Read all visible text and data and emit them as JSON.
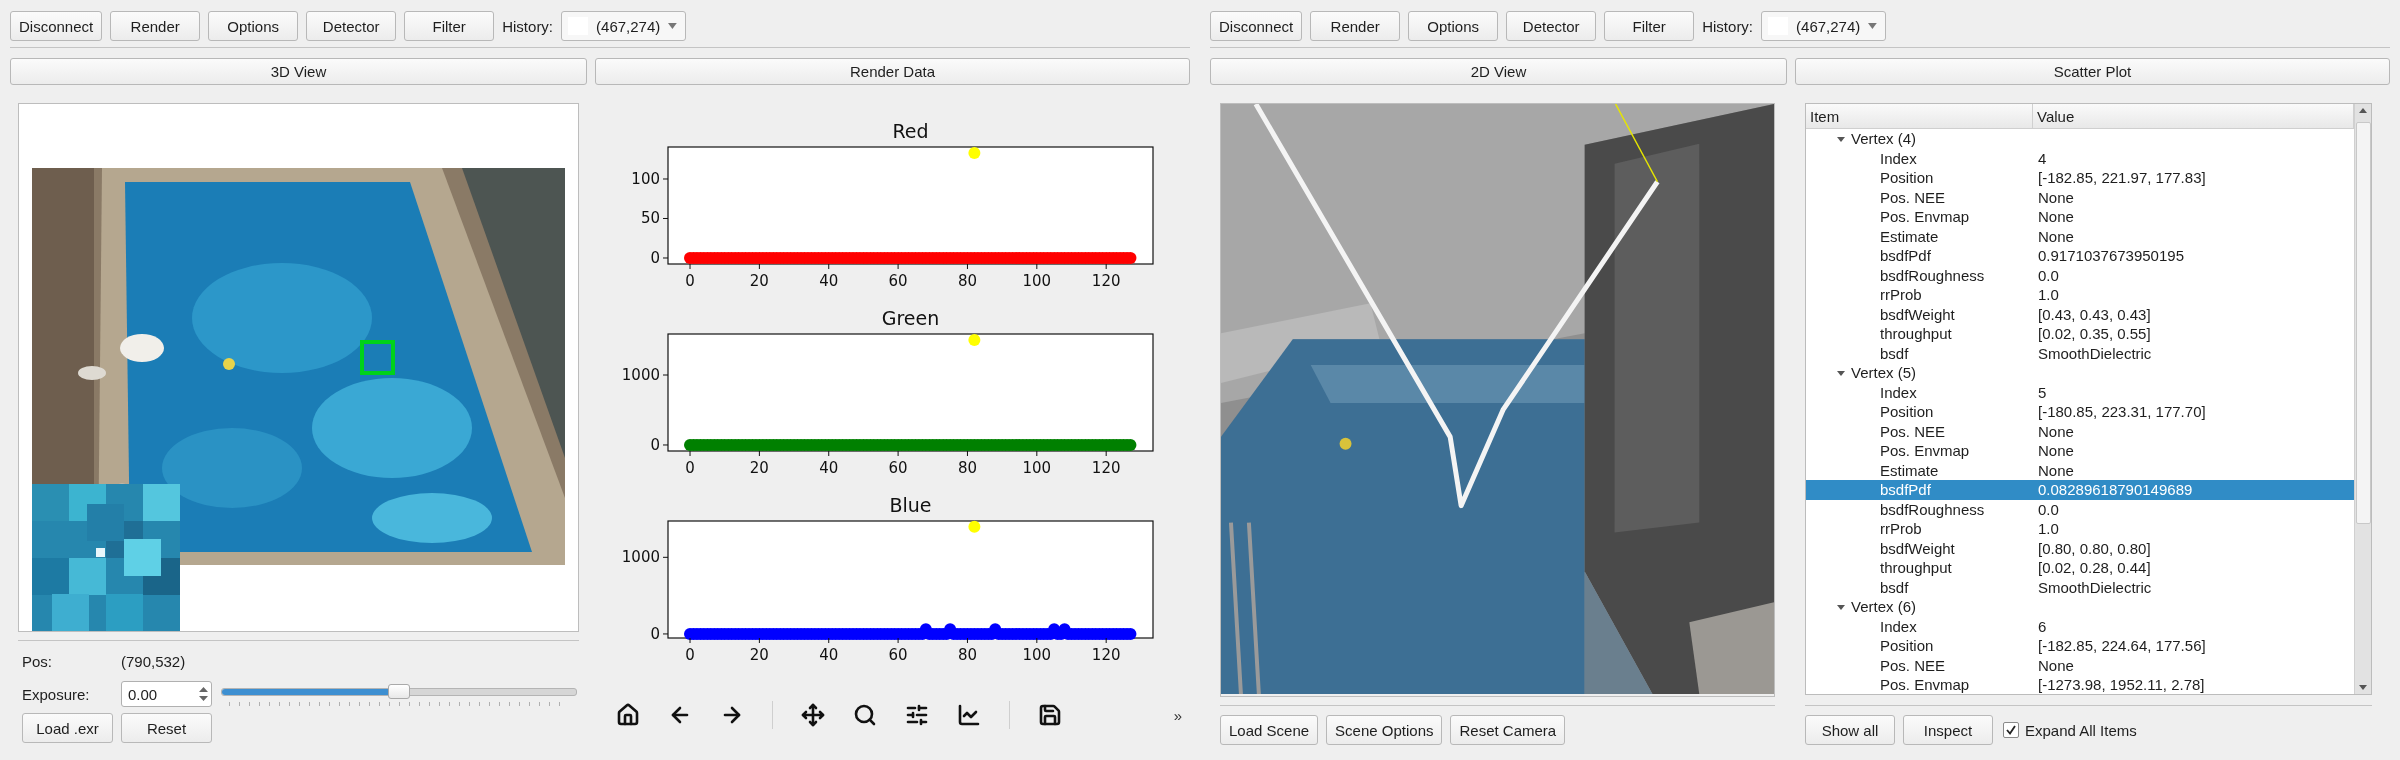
{
  "left": {
    "toolbar": {
      "buttons": [
        "Disconnect",
        "Render",
        "Options",
        "Detector",
        "Filter"
      ],
      "history_label": "History:",
      "history_value": "(467,274)"
    },
    "view_headers": [
      "3D View",
      "Render Data"
    ],
    "view_3d": {
      "pos_label": "Pos:",
      "pos_value": "(790,532)",
      "exposure_label": "Exposure:",
      "exposure_value": "0.00",
      "exposure_slider": {
        "level": 0.5
      },
      "buttons": [
        "Load .exr",
        "Reset"
      ]
    },
    "render_data": {
      "charts": [
        {
          "chart_data": {
            "type": "scatter",
            "title": "Red",
            "xlim": [
              -6.35,
              133.5
            ],
            "ylim": [
              -7.6,
              140.5
            ],
            "xticks": [
              0,
              20,
              40,
              60,
              80,
              100,
              120
            ],
            "yticks": [
              0,
              50,
              100
            ],
            "x": [
              0,
              1,
              2,
              3,
              4,
              5,
              6,
              7,
              8,
              9,
              10,
              11,
              12,
              13,
              14,
              15,
              16,
              17,
              18,
              19,
              20,
              21,
              22,
              23,
              24,
              25,
              26,
              27,
              28,
              29,
              30,
              31,
              32,
              33,
              34,
              35,
              36,
              37,
              38,
              39,
              40,
              41,
              42,
              43,
              44,
              45,
              46,
              47,
              48,
              49,
              50,
              51,
              52,
              53,
              54,
              55,
              56,
              57,
              58,
              59,
              60,
              61,
              62,
              63,
              64,
              65,
              66,
              67,
              68,
              69,
              70,
              71,
              72,
              73,
              74,
              75,
              76,
              77,
              78,
              79,
              80,
              81,
              82,
              83,
              84,
              85,
              86,
              87,
              88,
              89,
              90,
              91,
              92,
              93,
              94,
              95,
              96,
              97,
              98,
              99,
              100,
              101,
              102,
              103,
              104,
              105,
              106,
              107,
              108,
              109,
              110,
              111,
              112,
              113,
              114,
              115,
              116,
              117,
              118,
              119,
              120,
              121,
              122,
              123,
              124,
              125,
              126,
              127
            ],
            "series": [
              {
                "color": "#ff0000",
                "values": [
                  0,
                  0,
                  0,
                  0,
                  0,
                  0,
                  0,
                  0,
                  0,
                  0,
                  0,
                  0,
                  0,
                  0,
                  0,
                  0,
                  0,
                  0,
                  0,
                  0,
                  0,
                  0,
                  0,
                  0,
                  0,
                  0,
                  0,
                  0,
                  0,
                  0,
                  0,
                  0,
                  0,
                  0,
                  0,
                  0,
                  0,
                  0,
                  0,
                  0,
                  0,
                  0,
                  0,
                  0,
                  0,
                  0,
                  0,
                  0,
                  0,
                  0,
                  0,
                  0,
                  0,
                  0,
                  0,
                  0,
                  0,
                  0,
                  0,
                  0,
                  0,
                  0,
                  0,
                  0,
                  0,
                  0,
                  0,
                  0,
                  0,
                  0,
                  0,
                  0,
                  0,
                  0,
                  0,
                  0,
                  0,
                  0,
                  0,
                  0,
                  0,
                  0,
                  0,
                  0,
                  0,
                  0,
                  0,
                  0,
                  0,
                  0,
                  0,
                  0,
                  0,
                  0,
                  0,
                  0,
                  0,
                  0,
                  0,
                  0,
                  0,
                  0,
                  0,
                  0,
                  0,
                  0,
                  0,
                  0,
                  0,
                  0,
                  0,
                  0,
                  0,
                  0,
                  0,
                  0,
                  0,
                  0,
                  0,
                  0,
                  0,
                  0,
                  0,
                  0,
                  0,
                  0,
                  0,
                  0
                ]
              },
              {
                "color": "#ffff00",
                "values": [
                  null,
                  null,
                  null,
                  null,
                  null,
                  null,
                  null,
                  null,
                  null,
                  null,
                  null,
                  null,
                  null,
                  null,
                  null,
                  null,
                  null,
                  null,
                  null,
                  null,
                  null,
                  null,
                  null,
                  null,
                  null,
                  null,
                  null,
                  null,
                  null,
                  null,
                  null,
                  null,
                  null,
                  null,
                  null,
                  null,
                  null,
                  null,
                  null,
                  null,
                  null,
                  null,
                  null,
                  null,
                  null,
                  null,
                  null,
                  null,
                  null,
                  null,
                  null,
                  null,
                  null,
                  null,
                  null,
                  null,
                  null,
                  null,
                  null,
                  null,
                  null,
                  null,
                  null,
                  null,
                  null,
                  null,
                  null,
                  null,
                  null,
                  null,
                  null,
                  null,
                  null,
                  null,
                  null,
                  null,
                  null,
                  null,
                  null,
                  null,
                  null,
                  null,
                  133,
                  null,
                  null,
                  null,
                  null,
                  null,
                  null,
                  null,
                  null,
                  null,
                  null,
                  null,
                  null,
                  null,
                  null,
                  null,
                  null,
                  null,
                  null,
                  null,
                  null,
                  null,
                  null,
                  null,
                  null,
                  null,
                  null,
                  null,
                  null,
                  null,
                  null,
                  null,
                  null,
                  null,
                  null,
                  null,
                  null,
                  null,
                  null,
                  null,
                  null,
                  null,
                  null,
                  null,
                  null,
                  null
                ]
              }
            ]
          }
        },
        {
          "chart_data": {
            "type": "scatter",
            "title": "Green",
            "xlim": [
              -6.35,
              133.5
            ],
            "ylim": [
              -86,
              1586
            ],
            "xticks": [
              0,
              20,
              40,
              60,
              80,
              100,
              120
            ],
            "yticks": [
              0,
              1000
            ],
            "x": [
              0,
              1,
              2,
              3,
              4,
              5,
              6,
              7,
              8,
              9,
              10,
              11,
              12,
              13,
              14,
              15,
              16,
              17,
              18,
              19,
              20,
              21,
              22,
              23,
              24,
              25,
              26,
              27,
              28,
              29,
              30,
              31,
              32,
              33,
              34,
              35,
              36,
              37,
              38,
              39,
              40,
              41,
              42,
              43,
              44,
              45,
              46,
              47,
              48,
              49,
              50,
              51,
              52,
              53,
              54,
              55,
              56,
              57,
              58,
              59,
              60,
              61,
              62,
              63,
              64,
              65,
              66,
              67,
              68,
              69,
              70,
              71,
              72,
              73,
              74,
              75,
              76,
              77,
              78,
              79,
              80,
              81,
              82,
              83,
              84,
              85,
              86,
              87,
              88,
              89,
              90,
              91,
              92,
              93,
              94,
              95,
              96,
              97,
              98,
              99,
              100,
              101,
              102,
              103,
              104,
              105,
              106,
              107,
              108,
              109,
              110,
              111,
              112,
              113,
              114,
              115,
              116,
              117,
              118,
              119,
              120,
              121,
              122,
              123,
              124,
              125,
              126,
              127
            ],
            "series": [
              {
                "color": "#008000",
                "values": [
                  0,
                  0,
                  0,
                  0,
                  0,
                  0,
                  0,
                  0,
                  0,
                  0,
                  0,
                  0,
                  0,
                  0,
                  0,
                  0,
                  0,
                  0,
                  0,
                  0,
                  0,
                  0,
                  0,
                  0,
                  0,
                  0,
                  0,
                  0,
                  0,
                  0,
                  0,
                  0,
                  0,
                  0,
                  0,
                  0,
                  0,
                  0,
                  0,
                  0,
                  0,
                  0,
                  0,
                  0,
                  0,
                  0,
                  0,
                  0,
                  0,
                  0,
                  0,
                  0,
                  0,
                  0,
                  0,
                  0,
                  0,
                  0,
                  0,
                  0,
                  0,
                  0,
                  0,
                  0,
                  0,
                  0,
                  0,
                  0,
                  0,
                  0,
                  0,
                  0,
                  0,
                  0,
                  0,
                  0,
                  0,
                  0,
                  0,
                  0,
                  0,
                  0,
                  0,
                  0,
                  0,
                  0,
                  0,
                  0,
                  0,
                  0,
                  0,
                  0,
                  0,
                  0,
                  0,
                  0,
                  0,
                  0,
                  0,
                  0,
                  0,
                  0,
                  0,
                  0,
                  0,
                  0,
                  0,
                  0,
                  0,
                  0,
                  0,
                  0,
                  0,
                  0,
                  0,
                  0,
                  0,
                  0,
                  0,
                  0,
                  0,
                  0,
                  0,
                  0,
                  0,
                  0,
                  0,
                  0
                ]
              },
              {
                "color": "#ffff00",
                "values": [
                  null,
                  null,
                  null,
                  null,
                  null,
                  null,
                  null,
                  null,
                  null,
                  null,
                  null,
                  null,
                  null,
                  null,
                  null,
                  null,
                  null,
                  null,
                  null,
                  null,
                  null,
                  null,
                  null,
                  null,
                  null,
                  null,
                  null,
                  null,
                  null,
                  null,
                  null,
                  null,
                  null,
                  null,
                  null,
                  null,
                  null,
                  null,
                  null,
                  null,
                  null,
                  null,
                  null,
                  null,
                  null,
                  null,
                  null,
                  null,
                  null,
                  null,
                  null,
                  null,
                  null,
                  null,
                  null,
                  null,
                  null,
                  null,
                  null,
                  null,
                  null,
                  null,
                  null,
                  null,
                  null,
                  null,
                  null,
                  null,
                  null,
                  null,
                  null,
                  null,
                  null,
                  null,
                  null,
                  null,
                  null,
                  null,
                  null,
                  null,
                  null,
                  null,
                  1500,
                  null,
                  null,
                  null,
                  null,
                  null,
                  null,
                  null,
                  null,
                  null,
                  null,
                  null,
                  null,
                  null,
                  null,
                  null,
                  null,
                  null,
                  null,
                  null,
                  null,
                  null,
                  null,
                  null,
                  null,
                  null,
                  null,
                  null,
                  null,
                  null,
                  null,
                  null,
                  null,
                  null,
                  null,
                  null,
                  null,
                  null,
                  null,
                  null,
                  null,
                  null,
                  null,
                  null,
                  null,
                  null
                ]
              }
            ]
          }
        },
        {
          "chart_data": {
            "type": "scatter",
            "title": "Blue",
            "xlim": [
              -6.35,
              133.5
            ],
            "ylim": [
              -53,
              1474
            ],
            "xticks": [
              0,
              20,
              40,
              60,
              80,
              100,
              120
            ],
            "yticks": [
              0,
              1000
            ],
            "x": [
              0,
              1,
              2,
              3,
              4,
              5,
              6,
              7,
              8,
              9,
              10,
              11,
              12,
              13,
              14,
              15,
              16,
              17,
              18,
              19,
              20,
              21,
              22,
              23,
              24,
              25,
              26,
              27,
              28,
              29,
              30,
              31,
              32,
              33,
              34,
              35,
              36,
              37,
              38,
              39,
              40,
              41,
              42,
              43,
              44,
              45,
              46,
              47,
              48,
              49,
              50,
              51,
              52,
              53,
              54,
              55,
              56,
              57,
              58,
              59,
              60,
              61,
              62,
              63,
              64,
              65,
              66,
              67,
              68,
              69,
              70,
              71,
              72,
              73,
              74,
              75,
              76,
              77,
              78,
              79,
              80,
              81,
              82,
              83,
              84,
              85,
              86,
              87,
              88,
              89,
              90,
              91,
              92,
              93,
              94,
              95,
              96,
              97,
              98,
              99,
              100,
              101,
              102,
              103,
              104,
              105,
              106,
              107,
              108,
              109,
              110,
              111,
              112,
              113,
              114,
              115,
              116,
              117,
              118,
              119,
              120,
              121,
              122,
              123,
              124,
              125,
              126,
              127
            ],
            "series": [
              {
                "color": "#0000ff",
                "values": [
                  0,
                  0,
                  0,
                  0,
                  0,
                  0,
                  0,
                  0,
                  0,
                  0,
                  0,
                  0,
                  0,
                  0,
                  0,
                  0,
                  0,
                  0,
                  0,
                  0,
                  0,
                  0,
                  0,
                  0,
                  0,
                  0,
                  0,
                  0,
                  0,
                  0,
                  0,
                  0,
                  0,
                  0,
                  0,
                  0,
                  0,
                  0,
                  0,
                  0,
                  0,
                  0,
                  0,
                  0,
                  0,
                  0,
                  0,
                  0,
                  0,
                  0,
                  0,
                  0,
                  0,
                  0,
                  0,
                  0,
                  0,
                  0,
                  0,
                  0,
                  0,
                  0,
                  0,
                  0,
                  0,
                  0,
                  0,
                  0,
                  60,
                  0,
                  0,
                  0,
                  0,
                  0,
                  0,
                  60,
                  0,
                  0,
                  0,
                  0,
                  0,
                  0,
                  0,
                  0,
                  0,
                  0,
                  0,
                  0,
                  60,
                  0,
                  0,
                  0,
                  0,
                  0,
                  0,
                  0,
                  0,
                  0,
                  0,
                  0,
                  0,
                  0,
                  0,
                  0,
                  0,
                  60,
                  0,
                  0,
                  60,
                  0,
                  0,
                  0,
                  0,
                  0,
                  0,
                  0,
                  0,
                  0,
                  0,
                  0,
                  0,
                  0,
                  0,
                  0,
                  0,
                  0,
                  0,
                  0
                ]
              },
              {
                "color": "#ffff00",
                "values": [
                  null,
                  null,
                  null,
                  null,
                  null,
                  null,
                  null,
                  null,
                  null,
                  null,
                  null,
                  null,
                  null,
                  null,
                  null,
                  null,
                  null,
                  null,
                  null,
                  null,
                  null,
                  null,
                  null,
                  null,
                  null,
                  null,
                  null,
                  null,
                  null,
                  null,
                  null,
                  null,
                  null,
                  null,
                  null,
                  null,
                  null,
                  null,
                  null,
                  null,
                  null,
                  null,
                  null,
                  null,
                  null,
                  null,
                  null,
                  null,
                  null,
                  null,
                  null,
                  null,
                  null,
                  null,
                  null,
                  null,
                  null,
                  null,
                  null,
                  null,
                  null,
                  null,
                  null,
                  null,
                  null,
                  null,
                  null,
                  null,
                  null,
                  null,
                  null,
                  null,
                  null,
                  null,
                  null,
                  null,
                  null,
                  null,
                  null,
                  null,
                  null,
                  null,
                  1400,
                  null,
                  null,
                  null,
                  null,
                  null,
                  null,
                  null,
                  null,
                  null,
                  null,
                  null,
                  null,
                  null,
                  null,
                  null,
                  null,
                  null,
                  null,
                  null,
                  null,
                  null,
                  null,
                  null,
                  null,
                  null,
                  null,
                  null,
                  null,
                  null,
                  null,
                  null,
                  null,
                  null,
                  null,
                  null,
                  null,
                  null,
                  null,
                  null,
                  null,
                  null,
                  null,
                  null,
                  null,
                  null
                ]
              }
            ]
          }
        }
      ],
      "toolbar_overflow": "»"
    }
  },
  "right": {
    "toolbar": {
      "buttons": [
        "Disconnect",
        "Render",
        "Options",
        "Detector",
        "Filter"
      ],
      "history_label": "History:",
      "history_value": "(467,274)"
    },
    "view_headers": [
      "2D View",
      "Scatter Plot"
    ],
    "view_2d": {
      "buttons": [
        "Load Scene",
        "Scene Options",
        "Reset Camera"
      ]
    },
    "scatter_plot": {
      "columns": [
        "Item",
        "Value"
      ],
      "rows": [
        {
          "label": "Vertex (4)",
          "expanded": true,
          "selected": false,
          "children": [
            {
              "item": "Index",
              "value": "4",
              "selected": false
            },
            {
              "item": "Position",
              "value": "[-182.85, 221.97, 177.83]",
              "selected": false
            },
            {
              "item": "Pos. NEE",
              "value": "None",
              "selected": false
            },
            {
              "item": "Pos. Envmap",
              "value": "None",
              "selected": false
            },
            {
              "item": "Estimate",
              "value": "None",
              "selected": false
            },
            {
              "item": "bsdfPdf",
              "value": "0.9171037673950195",
              "selected": false
            },
            {
              "item": "bsdfRoughness",
              "value": "0.0",
              "selected": false
            },
            {
              "item": "rrProb",
              "value": "1.0",
              "selected": false
            },
            {
              "item": "bsdfWeight",
              "value": "[0.43, 0.43, 0.43]",
              "selected": false
            },
            {
              "item": "throughput",
              "value": "[0.02, 0.35, 0.55]",
              "selected": false
            },
            {
              "item": "bsdf",
              "value": "SmoothDielectric",
              "selected": false
            }
          ]
        },
        {
          "label": "Vertex (5)",
          "expanded": true,
          "selected": false,
          "children": [
            {
              "item": "Index",
              "value": "5",
              "selected": false
            },
            {
              "item": "Position",
              "value": "[-180.85, 223.31, 177.70]",
              "selected": false
            },
            {
              "item": "Pos. NEE",
              "value": "None",
              "selected": false
            },
            {
              "item": "Pos. Envmap",
              "value": "None",
              "selected": false
            },
            {
              "item": "Estimate",
              "value": "None",
              "selected": false
            },
            {
              "item": "bsdfPdf",
              "value": "0.08289618790149689",
              "selected": true
            },
            {
              "item": "bsdfRoughness",
              "value": "0.0",
              "selected": false
            },
            {
              "item": "rrProb",
              "value": "1.0",
              "selected": false
            },
            {
              "item": "bsdfWeight",
              "value": "[0.80, 0.80, 0.80]",
              "selected": false
            },
            {
              "item": "throughput",
              "value": "[0.02, 0.28, 0.44]",
              "selected": false
            },
            {
              "item": "bsdf",
              "value": "SmoothDielectric",
              "selected": false
            }
          ]
        },
        {
          "label": "Vertex (6)",
          "expanded": true,
          "selected": false,
          "children": [
            {
              "item": "Index",
              "value": "6",
              "selected": false
            },
            {
              "item": "Position",
              "value": "[-182.85, 224.64, 177.56]",
              "selected": false
            },
            {
              "item": "Pos. NEE",
              "value": "None",
              "selected": false
            },
            {
              "item": "Pos. Envmap",
              "value": "[-1273.98, 1952.11, 2.78]",
              "selected": false
            }
          ]
        }
      ],
      "buttons": [
        "Show all",
        "Inspect"
      ],
      "expand_all": {
        "label": "Expand All Items",
        "checked": true
      }
    }
  }
}
